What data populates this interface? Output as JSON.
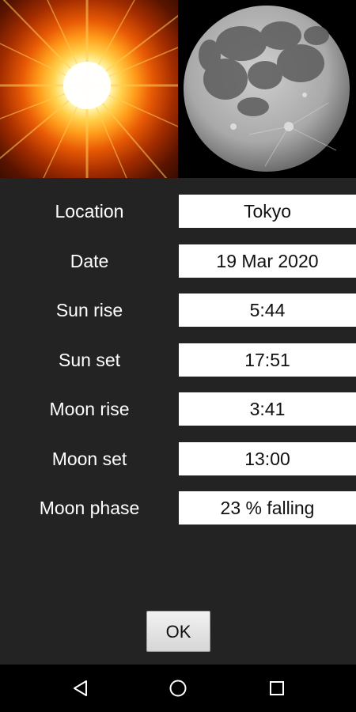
{
  "images": {
    "sun": "sun-icon",
    "moon": "moon-icon"
  },
  "rows": [
    {
      "label": "Location",
      "value": "Tokyo"
    },
    {
      "label": "Date",
      "value": "19 Mar 2020"
    },
    {
      "label": "Sun rise",
      "value": "5:44"
    },
    {
      "label": "Sun set",
      "value": "17:51"
    },
    {
      "label": "Moon rise",
      "value": "3:41"
    },
    {
      "label": "Moon set",
      "value": "13:00"
    },
    {
      "label": "Moon phase",
      "value": "23 % falling"
    }
  ],
  "ok_label": "OK",
  "navbar": {
    "back": "back-triangle-icon",
    "home": "home-circle-icon",
    "recents": "recents-square-icon"
  },
  "colors": {
    "background": "#232323",
    "field": "#ffffff",
    "navbar": "#000000"
  }
}
